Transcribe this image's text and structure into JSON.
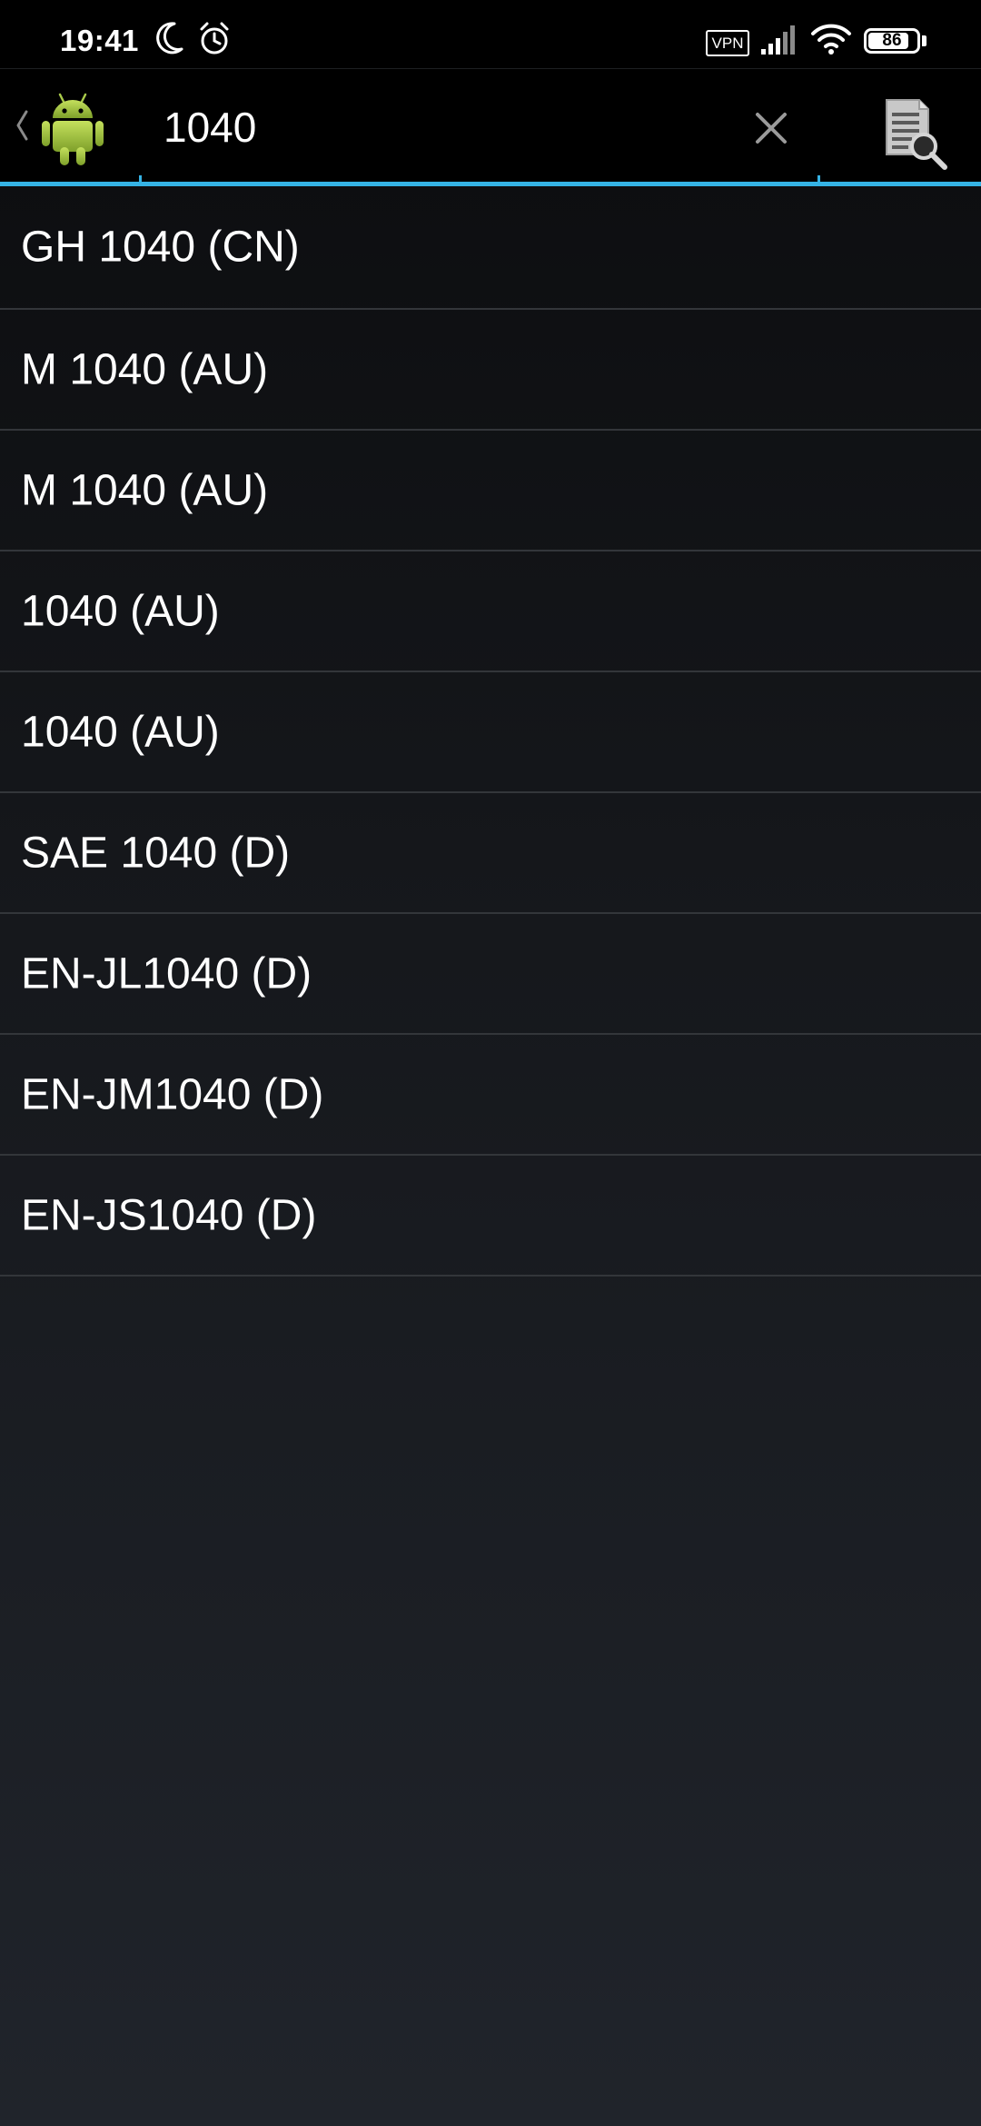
{
  "status_bar": {
    "time": "19:41",
    "vpn_label": "VPN",
    "battery_level": "86",
    "battery_fraction": 0.86,
    "icons": [
      "moon-icon",
      "alarm-icon",
      "signal-icon",
      "wifi-icon"
    ]
  },
  "search": {
    "query": "1040",
    "icons": {
      "up": "chevron-left-icon",
      "logo": "android-logo-icon",
      "clear": "close-icon",
      "action": "document-search-icon"
    }
  },
  "results": [
    "GH 1040 (CN)",
    "M 1040 (AU)",
    "M 1040 (AU)",
    "1040 (AU)",
    "1040 (AU)",
    "SAE 1040 (D)",
    "EN-JL1040 (D)",
    "EN-JM1040 (D)",
    "EN-JS1040 (D)"
  ],
  "colors": {
    "accent": "#35b3e5",
    "android_green": "#9fc33c",
    "divider": "#33363a"
  }
}
